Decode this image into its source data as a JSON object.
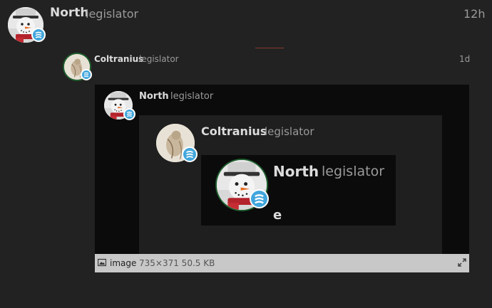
{
  "post": {
    "author": "North",
    "user_title": "legislator",
    "time": "12h"
  },
  "reply": {
    "author": "Coltranius",
    "user_title": "legislator",
    "time": "1d"
  },
  "embed": {
    "level1": {
      "author": "North",
      "user_title": "legislator"
    },
    "level2": {
      "author": "Coltranius",
      "user_title": "legislator"
    },
    "level3": {
      "author": "North",
      "user_title": "legislator",
      "body": "e"
    }
  },
  "image_meta": {
    "icon": "image-icon",
    "label": "image",
    "info": "735×371 50.5 KB",
    "expand_icon": "expand-icon"
  },
  "colors": {
    "background": "#222222",
    "flair": "#41a6dd",
    "embed_dark": "#0b0b0b",
    "meta_bar": "#c8c8c8"
  }
}
